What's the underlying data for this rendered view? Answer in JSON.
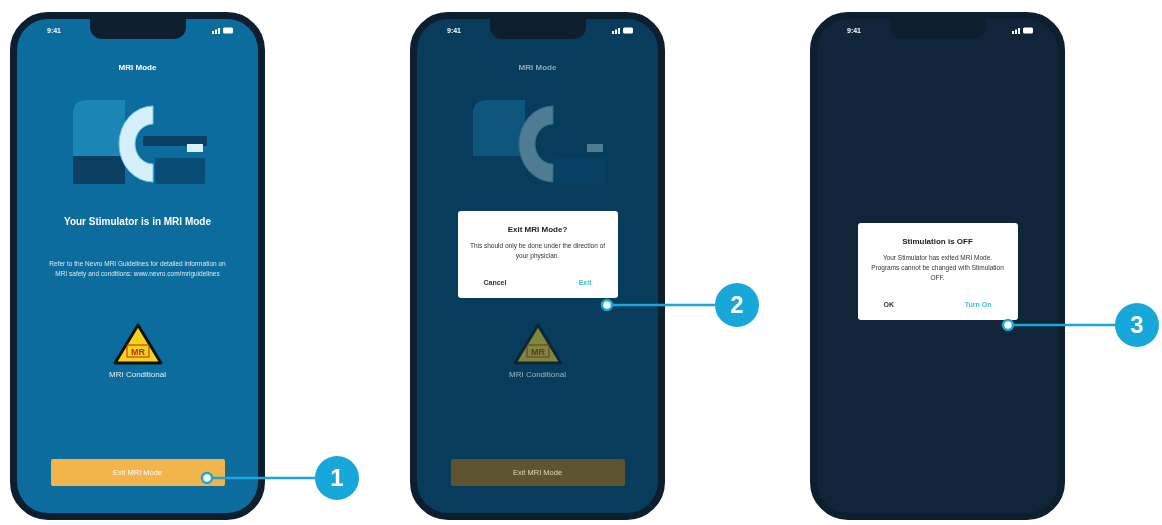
{
  "phones": [
    {
      "kind": "mri_mode",
      "dimmed": false,
      "status_time": "9:41",
      "title": "MRI Mode",
      "headline": "Your Stimulator is in MRI Mode",
      "body": "Refer to the Nevro MRI Guidelines for detailed information on MRI safety and conditions: www.nevro.com/mriguidelines",
      "warning_mark": "MR",
      "warning_label": "MRI Conditional",
      "button": "Exit MRI Mode",
      "callout": "1"
    },
    {
      "kind": "mri_mode",
      "dimmed": true,
      "status_time": "9:41",
      "title": "MRI Mode",
      "warning_mark": "MR",
      "warning_label": "MRI Conditional",
      "button": "Exit MRI Mode",
      "dialog": {
        "title": "Exit MRI Mode?",
        "message": "This should only be done under the direction of your physician.",
        "buttons": [
          {
            "label": "Cancel",
            "emphasis": false
          },
          {
            "label": "Exit",
            "emphasis": true
          }
        ]
      },
      "callout": "2"
    },
    {
      "kind": "blank",
      "dimmed": false,
      "status_time": "9:41",
      "dialog": {
        "title": "Stimulation is OFF",
        "message": "Your Stimulator has exited MRI Mode. Programs cannot be changed with Stimulation OFF.",
        "buttons": [
          {
            "label": "OK",
            "emphasis": false
          },
          {
            "label": "Turn On",
            "emphasis": true
          }
        ]
      },
      "callout": "3"
    }
  ]
}
